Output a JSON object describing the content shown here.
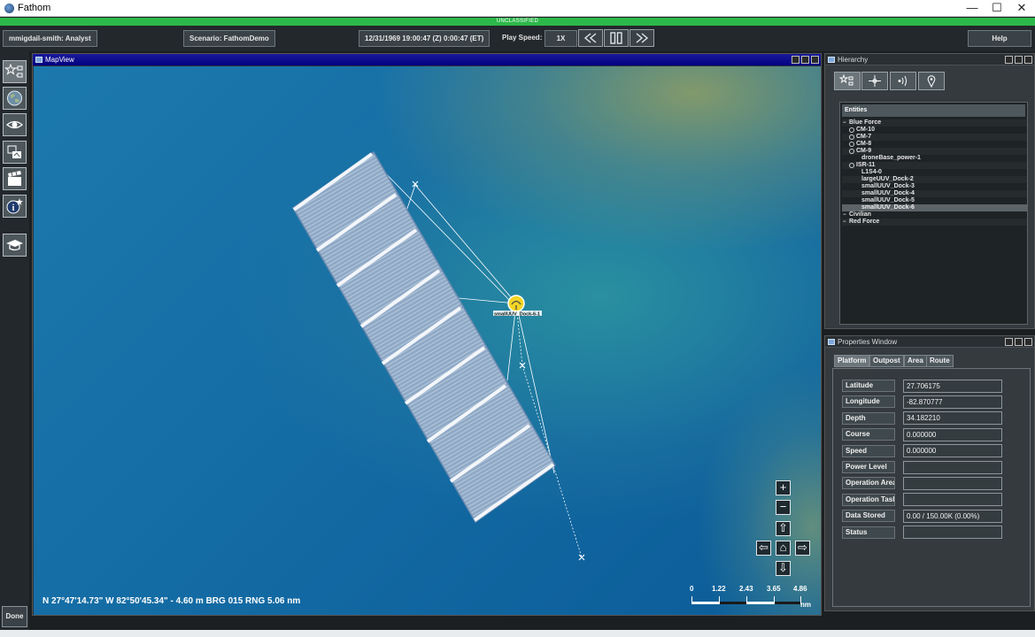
{
  "window": {
    "title": "Fathom",
    "minimize": "—",
    "maximize": "☐",
    "close": "✕"
  },
  "classification": "UNCLASSIFIED",
  "toolbar": {
    "user": "mmigdail-smith: Analyst",
    "scenario": "Scenario: FathomDemo",
    "datetime": "12/31/1969 19:00:47 (Z) 0:00:47 (ET)",
    "play_speed_label": "Play Speed:",
    "play_speed": "1X",
    "help": "Help"
  },
  "left_tools": {
    "items": [
      "entities-icon",
      "globe-icon",
      "eye-icon",
      "layers-icon",
      "clapper-icon",
      "info-icon",
      "graduation-cap-icon"
    ],
    "done": "Done"
  },
  "map": {
    "title": "MapView",
    "coords": "N 27°47'14.73\" W 82°50'45.34\"  - 4.60 m  BRG 015  RNG 5.06 nm",
    "scale_ticks": [
      "0",
      "1.22",
      "2.43",
      "3.65",
      "4.86"
    ],
    "scale_unit": "nm",
    "entity_label": "smallUUV_Dock-6-1"
  },
  "hierarchy": {
    "title": "Hierarchy",
    "header": "Entities",
    "tree": [
      {
        "label": "Blue Force",
        "level": 0,
        "expandable": false
      },
      {
        "label": "CM-10",
        "level": 1,
        "expandable": true
      },
      {
        "label": "CM-7",
        "level": 1,
        "expandable": true
      },
      {
        "label": "CM-8",
        "level": 1,
        "expandable": true
      },
      {
        "label": "CM-9",
        "level": 1,
        "expandable": true
      },
      {
        "label": "droneBase_power-1",
        "level": 2,
        "expandable": false
      },
      {
        "label": "ISR-11",
        "level": 1,
        "expandable": true
      },
      {
        "label": "L1S4-0",
        "level": 2,
        "expandable": false
      },
      {
        "label": "largeUUV_Dock-2",
        "level": 2,
        "expandable": false
      },
      {
        "label": "smallUUV_Dock-3",
        "level": 2,
        "expandable": false
      },
      {
        "label": "smallUUV_Dock-4",
        "level": 2,
        "expandable": false
      },
      {
        "label": "smallUUV_Dock-5",
        "level": 2,
        "expandable": false
      },
      {
        "label": "smallUUV_Dock-6",
        "level": 2,
        "expandable": false,
        "selected": true
      },
      {
        "label": "Civilian",
        "level": 0,
        "expandable": false
      },
      {
        "label": "Red Force",
        "level": 0,
        "expandable": false
      }
    ]
  },
  "properties": {
    "title": "Properties Window",
    "tabs": [
      "Platform",
      "Outpost",
      "Area",
      "Route"
    ],
    "fields": [
      {
        "label": "Latitude",
        "value": "27.706175"
      },
      {
        "label": "Longitude",
        "value": "-82.870777"
      },
      {
        "label": "Depth",
        "value": "34.182210"
      },
      {
        "label": "Course",
        "value": "0.000000"
      },
      {
        "label": "Speed",
        "value": "0.000000"
      },
      {
        "label": "Power Level",
        "value": ""
      },
      {
        "label": "Operation Area",
        "value": ""
      },
      {
        "label": "Operation Task",
        "value": ""
      },
      {
        "label": "Data Stored",
        "value": "0.00 / 150.00K (0.00%)"
      },
      {
        "label": "Status",
        "value": ""
      }
    ]
  }
}
